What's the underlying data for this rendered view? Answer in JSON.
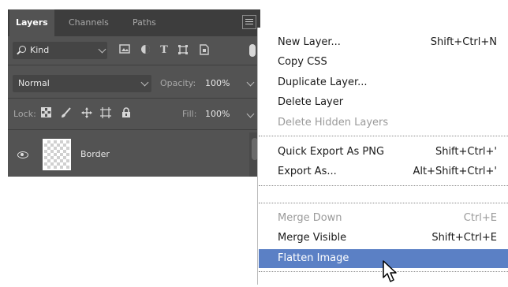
{
  "panel": {
    "tabs": [
      "Layers",
      "Channels",
      "Paths"
    ],
    "filter_kind_label": "Kind",
    "filter_icons": [
      "image-filter-icon",
      "adjustment-filter-icon",
      "type-filter-icon",
      "shape-filter-icon",
      "smart-object-filter-icon"
    ],
    "blend_mode": "Normal",
    "opacity_label": "Opacity:",
    "opacity_value": "100%",
    "lock_label": "Lock:",
    "fill_label": "Fill:",
    "fill_value": "100%",
    "layers": [
      {
        "name": "Border",
        "visible": true
      }
    ]
  },
  "menu": {
    "items": [
      {
        "label": "New Layer...",
        "shortcut": "Shift+Ctrl+N",
        "disabled": false
      },
      {
        "label": "Copy CSS",
        "shortcut": "",
        "disabled": false
      },
      {
        "label": "Duplicate Layer...",
        "shortcut": "",
        "disabled": false
      },
      {
        "label": "Delete Layer",
        "shortcut": "",
        "disabled": false
      },
      {
        "label": "Delete Hidden Layers",
        "shortcut": "",
        "disabled": true
      },
      {
        "label": "Quick Export As PNG",
        "shortcut": "Shift+Ctrl+'",
        "disabled": false
      },
      {
        "label": "Export As...",
        "shortcut": "Alt+Shift+Ctrl+'",
        "disabled": false
      },
      {
        "label": "Merge Down",
        "shortcut": "Ctrl+E",
        "disabled": true
      },
      {
        "label": "Merge Visible",
        "shortcut": "Shift+Ctrl+E",
        "disabled": false
      },
      {
        "label": "Flatten Image",
        "shortcut": "",
        "disabled": false
      }
    ],
    "highlighted_item": "Flatten Image",
    "highlight_color": "#5b80c5"
  }
}
